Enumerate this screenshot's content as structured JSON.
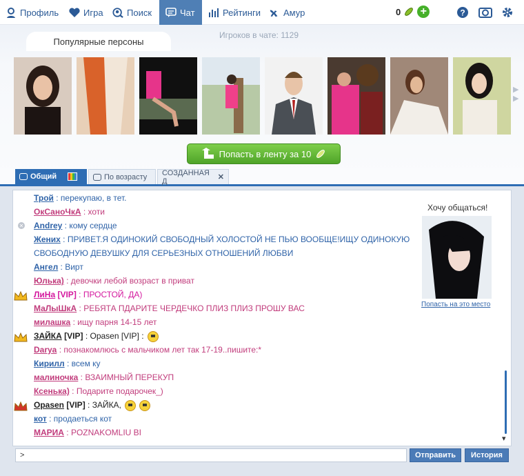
{
  "nav": {
    "profile": "Профиль",
    "games": "Игра",
    "search": "Поиск",
    "chat": "Чат",
    "ratings": "Рейтинги",
    "amur": "Амур",
    "coins": "0"
  },
  "popular": {
    "tab_label": "Популярные персоны",
    "players_label": "Игроков в чате:  1129",
    "feed_button": "Попасть в ленту за 10"
  },
  "chat_tabs": {
    "general": "Общий",
    "by_age": "По возрасту",
    "created": "СОЗДАННАЯ Д"
  },
  "messages": [
    {
      "nick": "Трой",
      "text": " : перекупаю, в тет.",
      "color": "blue"
    },
    {
      "nick": "ОкСаноЧкА",
      "text": " : хоти",
      "color": "pink"
    },
    {
      "nick": "Andrey",
      "text": " : кому сердце",
      "color": "blue"
    },
    {
      "nick": "Жених",
      "text": " : ПРИВЕТ.Я ОДИНОКИЙ СВОБОДНЫЙ ХОЛОСТОЙ НЕ ПЬЮ ВООБЩЕ!ИЩУ ОДИНОКУЮ",
      "color": "blue"
    },
    {
      "nick": "",
      "text": "СВОБОДНУЮ ДЕВУШКУ ДЛЯ СЕРЬЕЗНЫХ ОТНОШЕНИЙ ЛЮБВИ",
      "color": "blue"
    },
    {
      "nick": "Ангел",
      "text": " : Вирт",
      "color": "blue"
    },
    {
      "nick": "Юлька)",
      "text": " : девочки лебой возраст в приват",
      "color": "pink"
    },
    {
      "nick": "ЛиНа",
      "vip": " [VIP]",
      "text": " : ПРОСТОЙ, ДА)",
      "color": "vip-pink"
    },
    {
      "nick": "МаЛыШкА",
      "text": " : РЕБЯТА ПДАРИТЕ ЧЕРДЕЧКО ПЛИЗ ПЛИЗ ПРОШУ ВАС",
      "color": "pink"
    },
    {
      "nick": "милашка",
      "text": " : ищу парня 14-15 лет",
      "color": "pink"
    },
    {
      "nick": "ЗАЙКА",
      "vip": " [VIP]",
      "text": " : Opasen [VIP] :",
      "color": "dark"
    },
    {
      "nick": "Darya",
      "text": " : познакомлюсь с мальчиком лет так 17-19..пишите:*",
      "color": "pink"
    },
    {
      "nick": "Кирилл",
      "text": " : всем ку",
      "color": "blue"
    },
    {
      "nick": "малиночка",
      "text": " : ВЗАИМНЫЙ ПЕРЕКУП",
      "color": "pink"
    },
    {
      "nick": "Ксенька)",
      "text": " : Подарите подарочек_)",
      "color": "pink"
    },
    {
      "nick": "Opasen",
      "vip": " [VIP]",
      "text": " : ЗАЙКА,",
      "color": "dark"
    },
    {
      "nick": "кот",
      "text": " : продаеться кот",
      "color": "blue"
    },
    {
      "nick": "МАРИА",
      "text": " : POZNAKOMLIU BI",
      "color": "pink"
    }
  ],
  "side": {
    "title": "Хочу общаться!",
    "link": "Попасть на это место"
  },
  "input": {
    "value": ">"
  },
  "buttons": {
    "send": "Отправить",
    "history": "История"
  }
}
